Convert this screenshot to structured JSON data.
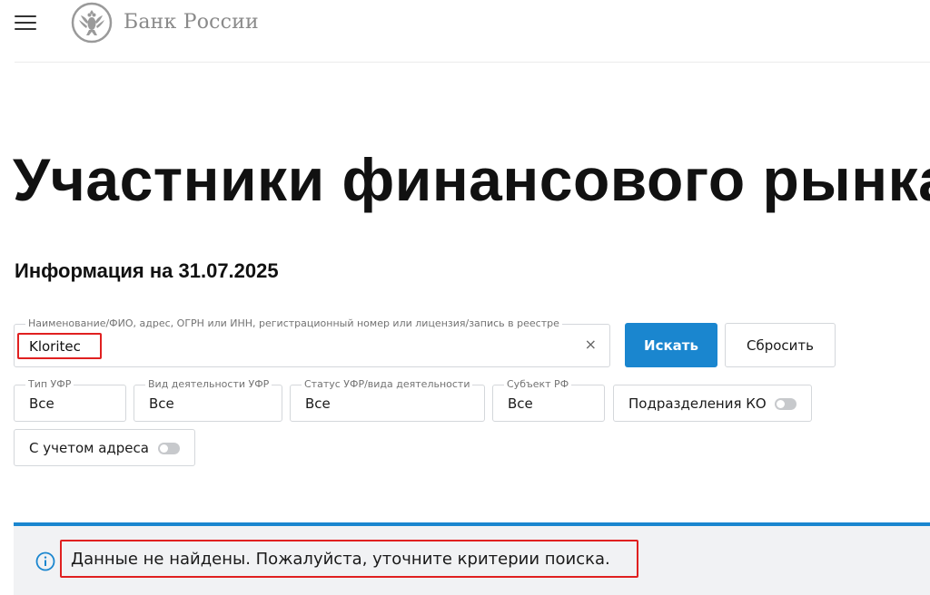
{
  "header": {
    "bank_name": "Банк России"
  },
  "page": {
    "title": "Участники финансового рынка",
    "info_date": "Информация на 31.07.2025"
  },
  "search": {
    "legend": "Наименование/ФИО, адрес, ОГРН или ИНН, регистрационный номер или лицензия/запись в реестре",
    "value": "Kloritec",
    "clear_symbol": "×",
    "search_label": "Искать",
    "reset_label": "Сбросить"
  },
  "filters": {
    "type": {
      "legend": "Тип УФР",
      "value": "Все"
    },
    "activity": {
      "legend": "Вид деятельности УФР",
      "value": "Все"
    },
    "status": {
      "legend": "Статус УФР/вида деятельности",
      "value": "Все"
    },
    "subject": {
      "legend": "Субъект РФ",
      "value": "Все"
    },
    "ko_divisions": {
      "label": "Подразделения КО",
      "on": false
    },
    "with_address": {
      "label": "С учетом адреса",
      "on": false
    }
  },
  "notice": {
    "text": "Данные не найдены. Пожалуйста, уточните критерии поиска."
  },
  "colors": {
    "accent": "#1a86cf",
    "highlight": "#e02020",
    "notice_bg": "#f1f2f4"
  }
}
